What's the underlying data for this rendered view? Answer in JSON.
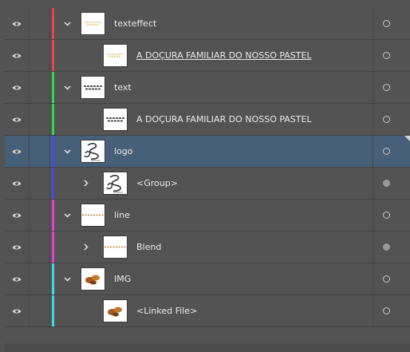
{
  "layers": [
    {
      "label": "texteffect",
      "level": 0,
      "expander": "expanded",
      "color": "#e0474c",
      "thumb": "texteffect",
      "underline": false,
      "selected": false,
      "target": "hollow"
    },
    {
      "label": "A DOÇURA FAMILIAR DO NOSSO PASTEL",
      "level": 1,
      "expander": "none",
      "color": "#e0474c",
      "thumb": "texteffect",
      "underline": true,
      "selected": false,
      "target": "hollow"
    },
    {
      "label": "text",
      "level": 0,
      "expander": "expanded",
      "color": "#35d64a",
      "thumb": "text",
      "underline": false,
      "selected": false,
      "target": "hollow"
    },
    {
      "label": "A DOÇURA FAMILIAR DO NOSSO PASTEL",
      "level": 1,
      "expander": "none",
      "color": "#35d64a",
      "thumb": "text",
      "underline": false,
      "selected": false,
      "target": "hollow"
    },
    {
      "label": "logo",
      "level": 0,
      "expander": "expanded",
      "color": "#4a4cdb",
      "thumb": "logo",
      "underline": false,
      "selected": true,
      "target": "hollow"
    },
    {
      "label": "<Group>",
      "level": 1,
      "expander": "collapsed",
      "color": "#4a4cdb",
      "thumb": "logo",
      "underline": false,
      "selected": false,
      "target": "filled"
    },
    {
      "label": "line",
      "level": 0,
      "expander": "expanded",
      "color": "#e63fd8",
      "thumb": "line",
      "underline": false,
      "selected": false,
      "target": "hollow"
    },
    {
      "label": "Blend",
      "level": 1,
      "expander": "collapsed",
      "color": "#e63fd8",
      "thumb": "line",
      "underline": false,
      "selected": false,
      "target": "filled"
    },
    {
      "label": "IMG",
      "level": 0,
      "expander": "expanded",
      "color": "#3fd9e6",
      "thumb": "img",
      "underline": false,
      "selected": false,
      "target": "hollow"
    },
    {
      "label": "<Linked File>",
      "level": 1,
      "expander": "none",
      "color": "#3fd9e6",
      "thumb": "img",
      "underline": false,
      "selected": false,
      "target": "hollow"
    }
  ],
  "icons": {
    "visibility": "eye-icon",
    "expanded": "chevron-down-icon",
    "collapsed": "chevron-right-icon",
    "target": "target-circle-icon"
  },
  "colors": {
    "panel_bg": "#535353",
    "selected_bg": "#46607a",
    "text": "#eaeaea"
  }
}
